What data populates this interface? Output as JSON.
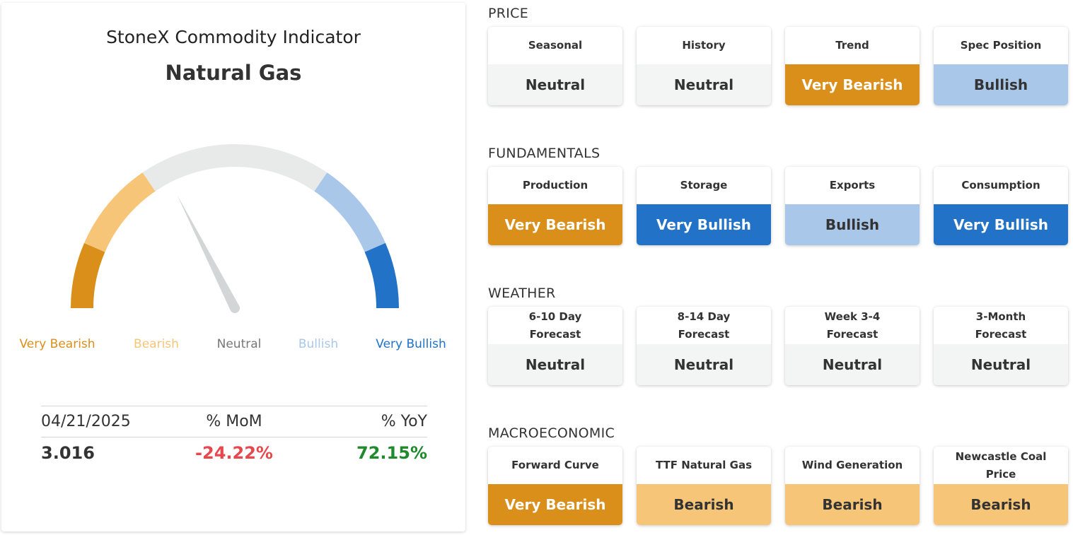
{
  "panel": {
    "title": "StoneX Commodity Indicator",
    "commodity": "Natural Gas"
  },
  "gauge": {
    "value_level": 0.35,
    "labels": [
      "Very Bearish",
      "Bearish",
      "Neutral",
      "Bullish",
      "Very Bullish"
    ],
    "colors": {
      "very_bearish": "#da8f1a",
      "bearish": "#f6c577",
      "neutral": "#e8e9e9",
      "bullish": "#a9c7e9",
      "very_bullish": "#2272c7",
      "needle": "#d3d6d6"
    }
  },
  "stats": {
    "date": "04/21/2025",
    "mom_label": "% MoM",
    "yoy_label": "% YoY",
    "price": "3.016",
    "mom": "-24.22%",
    "yoy": "72.15%"
  },
  "sections": [
    {
      "title": "PRICE",
      "cards": [
        {
          "label": "Seasonal",
          "value": "Neutral"
        },
        {
          "label": "History",
          "value": "Neutral"
        },
        {
          "label": "Trend",
          "value": "Very Bearish"
        },
        {
          "label": "Spec Position",
          "value": "Bullish"
        }
      ]
    },
    {
      "title": "FUNDAMENTALS",
      "cards": [
        {
          "label": "Production",
          "value": "Very Bearish"
        },
        {
          "label": "Storage",
          "value": "Very Bullish"
        },
        {
          "label": "Exports",
          "value": "Bullish"
        },
        {
          "label": "Consumption",
          "value": "Very Bullish"
        }
      ]
    },
    {
      "title": "WEATHER",
      "cards": [
        {
          "label": "6-10 Day Forecast",
          "value": "Neutral"
        },
        {
          "label": "8-14 Day Forecast",
          "value": "Neutral"
        },
        {
          "label": "Week 3-4 Forecast",
          "value": "Neutral"
        },
        {
          "label": "3-Month Forecast",
          "value": "Neutral"
        }
      ]
    },
    {
      "title": "MACROECONOMIC",
      "cards": [
        {
          "label": "Forward Curve",
          "value": "Very Bearish"
        },
        {
          "label": "TTF Natural Gas",
          "value": "Bearish"
        },
        {
          "label": "Wind Generation",
          "value": "Bearish"
        },
        {
          "label": "Newcastle Coal Price",
          "value": "Bearish"
        }
      ]
    }
  ]
}
